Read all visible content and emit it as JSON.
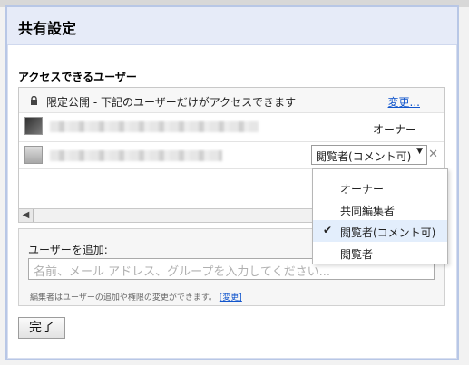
{
  "dialog": {
    "title": "共有設定",
    "access_section_label": "アクセスできるユーザー",
    "visibility": {
      "text": "限定公開 - 下記のユーザーだけがアクセスできます",
      "change_link": "変更..."
    },
    "users": [
      {
        "role": "オーナー"
      },
      {
        "role": "閲覧者(コメント可)"
      }
    ],
    "role_dropdown": {
      "options": [
        "オーナー",
        "共同編集者",
        "閲覧者(コメント可)",
        "閲覧者"
      ],
      "selected": "閲覧者(コメント可)"
    },
    "add_users": {
      "label": "ユーザーを追加:",
      "placeholder": "名前、メール アドレス、グループを入力してください...",
      "hint": "編集者はユーザーの追加や権限の変更ができます。",
      "hint_link": "[変更]"
    },
    "done_button": "完了"
  },
  "icons": {
    "lock": "lock-icon",
    "chevron": "chevron-down-icon",
    "remove": "close-icon",
    "check": "check-icon",
    "scroll_left": "arrow-left-icon"
  },
  "colors": {
    "title_bar": "#e6ebf8",
    "link": "#1155cc",
    "selected_option": "#e3eefc"
  }
}
